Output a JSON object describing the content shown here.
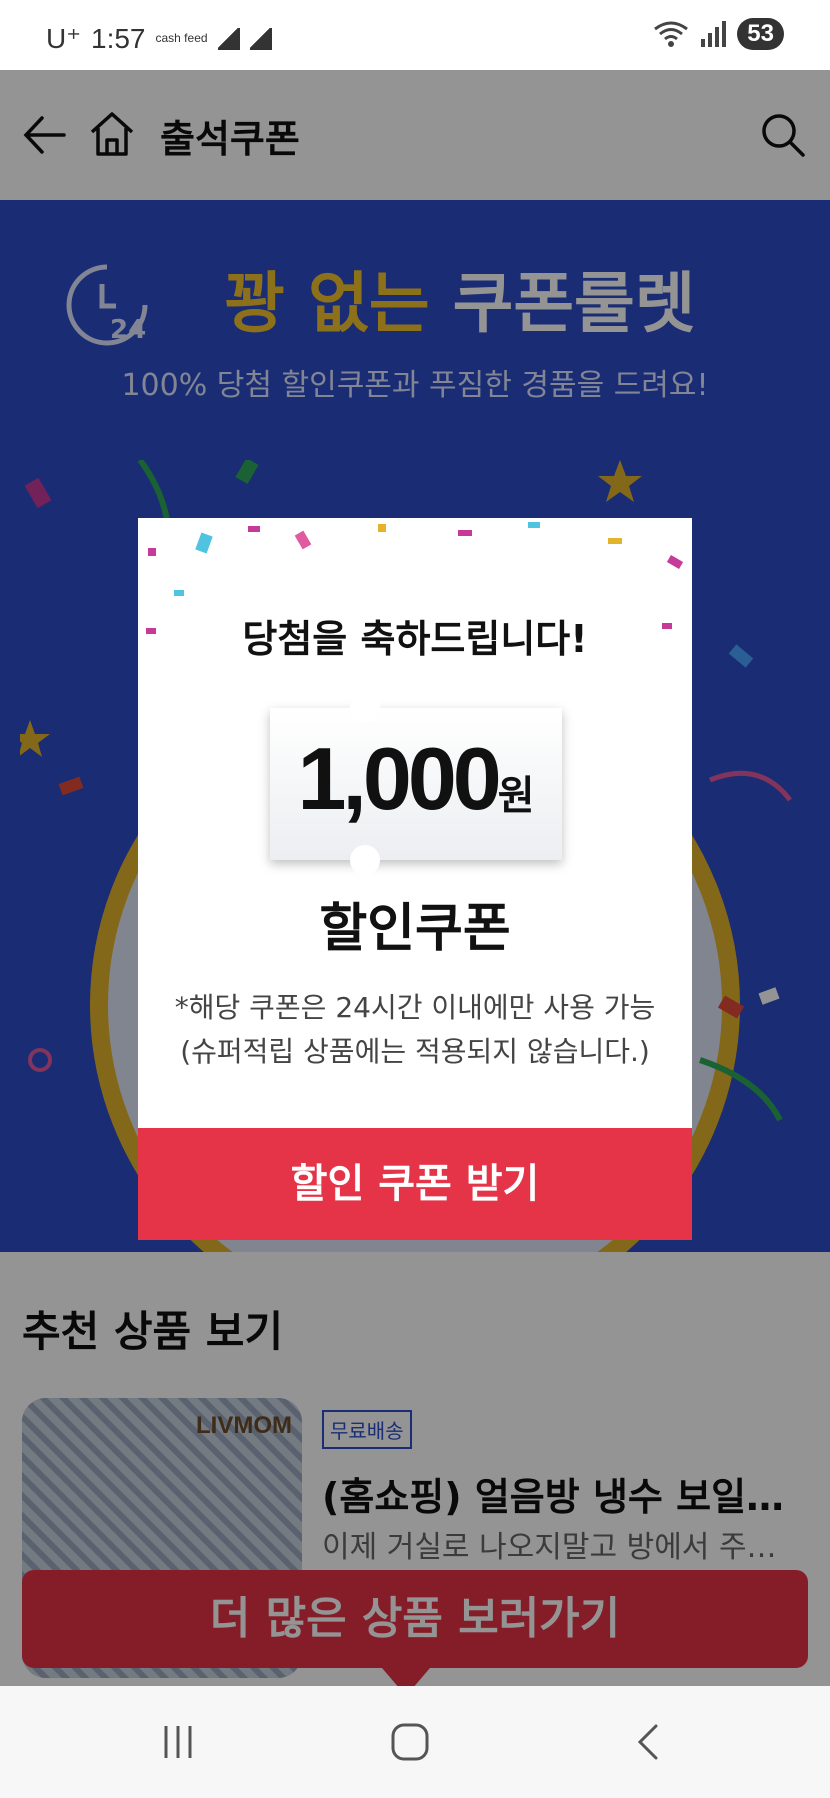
{
  "status_bar": {
    "carrier": "U⁺",
    "time": "1:57",
    "app_badge": "cash feed",
    "battery": "53",
    "icons": [
      "cashfeed-icon",
      "notification-icon",
      "wifi-icon",
      "signal-icon",
      "battery-icon"
    ]
  },
  "header": {
    "title": "출석쿠폰",
    "icons": [
      "back-arrow-icon",
      "home-icon",
      "search-icon"
    ]
  },
  "banner": {
    "clock_label": "24",
    "headline_gold": "꽝 없는",
    "headline_white": "쿠폰룰렛",
    "subtitle": "100% 당첨 할인쿠폰과 푸짐한 경품을 드려요!",
    "colors": {
      "background": "#2d4cc6",
      "gold": "#f2c12e",
      "wheel_rim": "#e3b42b"
    }
  },
  "recommend": {
    "title": "추천 상품 보기",
    "product": {
      "brand": "LIVMOM",
      "badge": "무료배송",
      "title": "(홈쇼핑) 얼음방 냉수 보일…",
      "desc": "이제 거실로 나오지말고 방에서 주…"
    },
    "more_button": "더 많은 상품 보러가기"
  },
  "modal": {
    "congrats": "당첨을 축하드립니다!",
    "amount": "1,000",
    "unit": "원",
    "coupon_type": "할인쿠폰",
    "note_line1": "*해당 쿠폰은 24시간 이내에만 사용 가능",
    "note_line2": "(슈퍼적립 상품에는 적용되지 않습니다.)",
    "cta": "할인 쿠폰 받기",
    "colors": {
      "cta": "#e53348"
    }
  },
  "navbar": {
    "icons": [
      "recents-icon",
      "home-circle-icon",
      "back-chevron-icon"
    ]
  }
}
